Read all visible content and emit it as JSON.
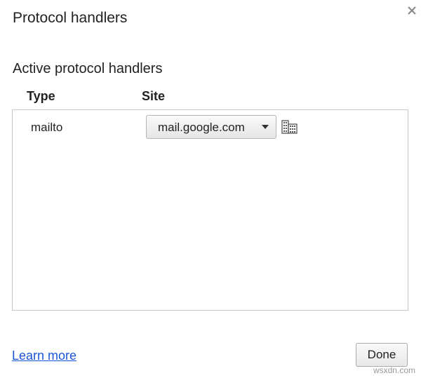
{
  "dialog": {
    "title": "Protocol handlers",
    "close_icon": "close-icon"
  },
  "section": {
    "heading": "Active protocol handlers"
  },
  "table": {
    "columns": [
      "Type",
      "Site"
    ],
    "rows": [
      {
        "type": "mailto",
        "site": "mail.google.com",
        "action_icon": "building-icon"
      }
    ]
  },
  "footer": {
    "learn_more": "Learn more",
    "done_label": "Done"
  },
  "watermark": "wsxdn.com",
  "colors": {
    "link": "#1a55d6",
    "border": "#c8c8c8"
  }
}
